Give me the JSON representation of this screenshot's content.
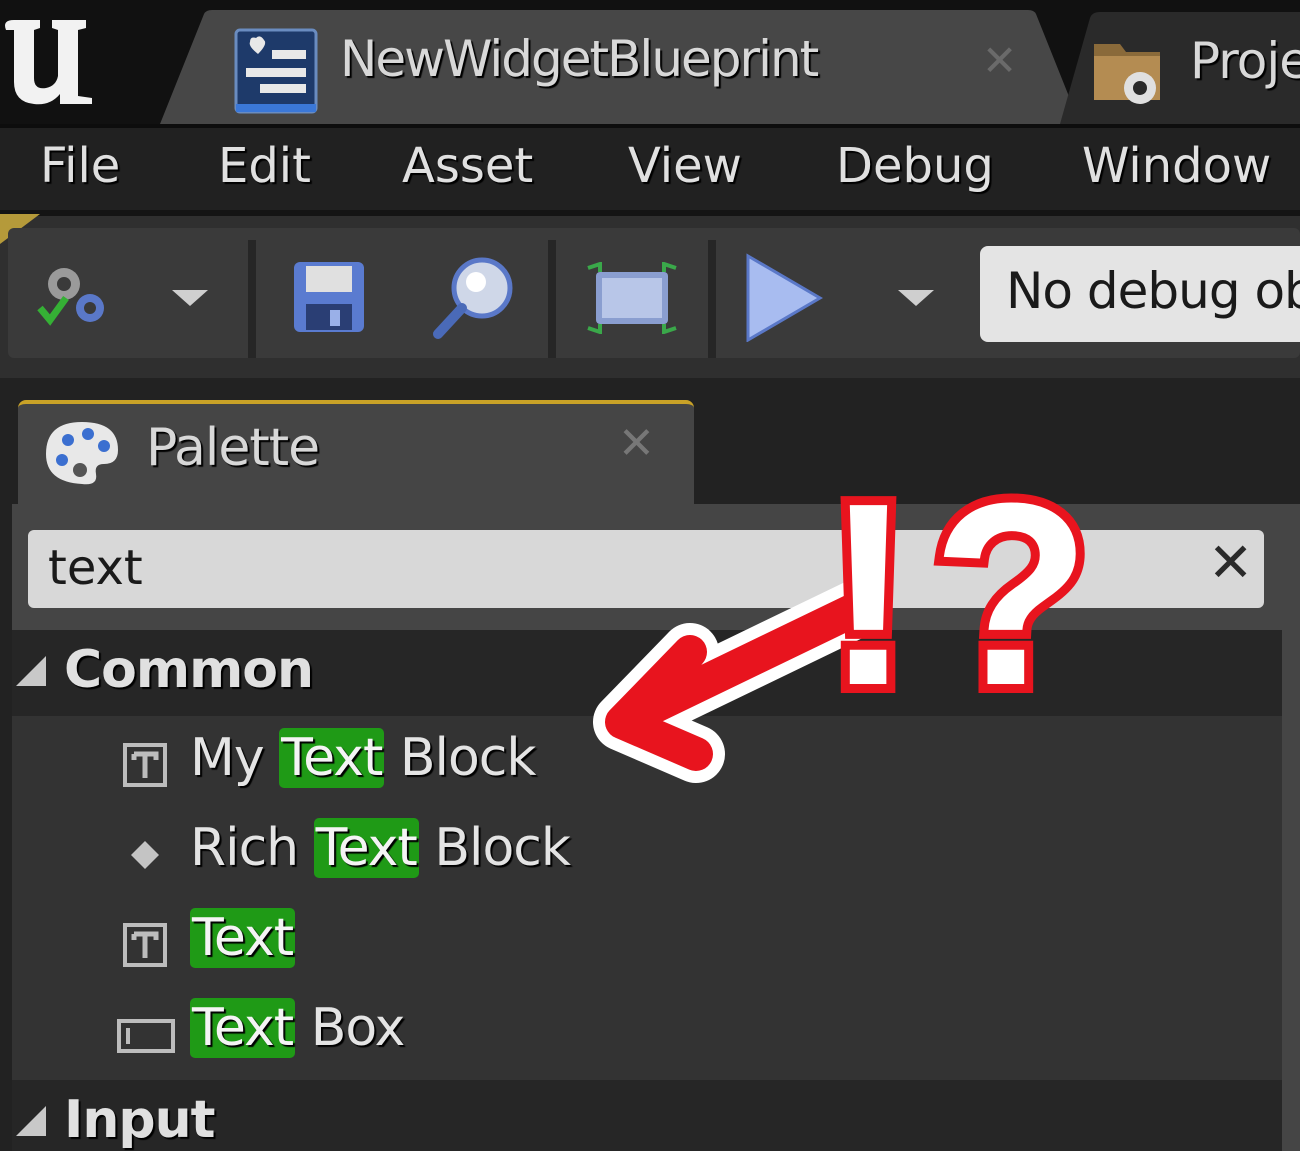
{
  "window": {
    "tabs": [
      {
        "label": "NewWidgetBlueprint",
        "active": true
      },
      {
        "label": "Proje",
        "active": false
      }
    ]
  },
  "menu": {
    "items": [
      "File",
      "Edit",
      "Asset",
      "View",
      "Debug",
      "Window"
    ]
  },
  "toolbar": {
    "buttons": [
      "compile-settings-icon",
      "save-icon",
      "find-icon",
      "widget-preview-icon",
      "play-icon"
    ],
    "debug_select_value": "No debug ob"
  },
  "palette": {
    "tab_label": "Palette",
    "search": {
      "value": "text"
    },
    "categories": [
      {
        "label": "Common",
        "items": [
          {
            "pre": "My ",
            "match": "Text",
            "post": " Block",
            "icon": "text-block-icon"
          },
          {
            "pre": "Rich ",
            "match": "Text",
            "post": " Block",
            "icon": "diamond-icon"
          },
          {
            "pre": "",
            "match": "Text",
            "post": "",
            "icon": "text-block-icon"
          },
          {
            "pre": "",
            "match": "Text",
            "post": " Box",
            "icon": "text-box-icon"
          }
        ]
      },
      {
        "label": "Input",
        "items": []
      }
    ]
  },
  "annotation": {
    "symbols": "!?",
    "color": "#e8141e"
  },
  "colors": {
    "search_highlight": "#1f9a16",
    "tab_accent": "#c9a227"
  }
}
